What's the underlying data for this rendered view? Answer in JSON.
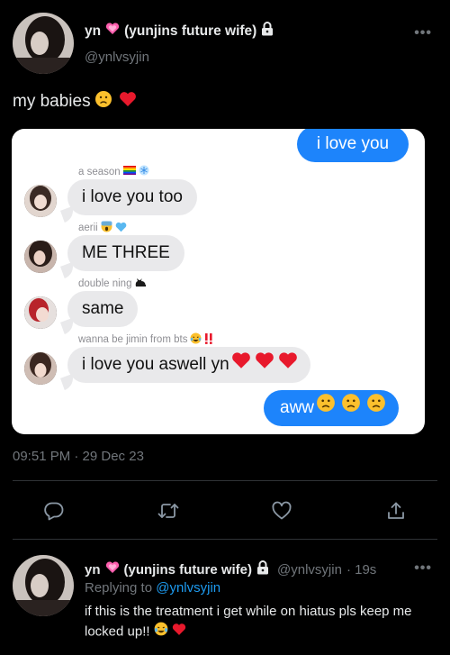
{
  "tweet": {
    "display_name": "yn",
    "name_suffix": "(yunjins future wife)",
    "handle": "@ynlvsyjin",
    "text": "my babies",
    "timestamp": "09:51 PM · 29 Dec 23",
    "more_icon": "more-icon"
  },
  "chat": {
    "outgoing_top": "i love you",
    "messages": [
      {
        "sender": "a season",
        "text": "i love you too"
      },
      {
        "sender": "aerii",
        "text": "ME THREE"
      },
      {
        "sender": "double ning",
        "text": "same"
      },
      {
        "sender": "wanna be jimin from bts",
        "text": "i love you aswell yn"
      }
    ],
    "outgoing_bottom": "aww"
  },
  "actions": {
    "reply_icon": "comment-icon",
    "retweet_icon": "retweet-icon",
    "like_icon": "heart-icon",
    "share_icon": "share-icon"
  },
  "reply": {
    "display_name": "yn",
    "name_suffix": "(yunjins future wife)",
    "handle": "@ynlvsyjin",
    "age": "· 19s",
    "replying_prefix": "Replying to",
    "replying_to": "@ynlvsyjin",
    "text": "if this is the treatment i get while on hiatus pls keep me locked up!!"
  },
  "colors": {
    "background": "#000000",
    "link_blue": "#1d9bf0",
    "imessage_blue": "#1d84fb",
    "incoming_gray": "#e9e9eb",
    "secondary_text": "#71767b"
  }
}
